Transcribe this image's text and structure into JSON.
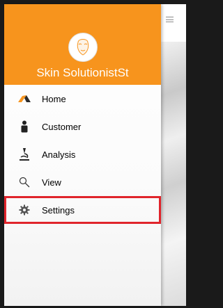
{
  "app": {
    "name": "Skin SolutionistSt"
  },
  "menu": {
    "items": [
      {
        "label": "Home",
        "icon": "home-icon"
      },
      {
        "label": "Customer",
        "icon": "person-icon"
      },
      {
        "label": "Analysis",
        "icon": "microscope-icon"
      },
      {
        "label": "View",
        "icon": "search-icon"
      },
      {
        "label": "Settings",
        "icon": "gear-icon",
        "highlighted": true
      }
    ]
  },
  "colors": {
    "header": "#f7941d",
    "highlight_border": "#e0242b"
  }
}
